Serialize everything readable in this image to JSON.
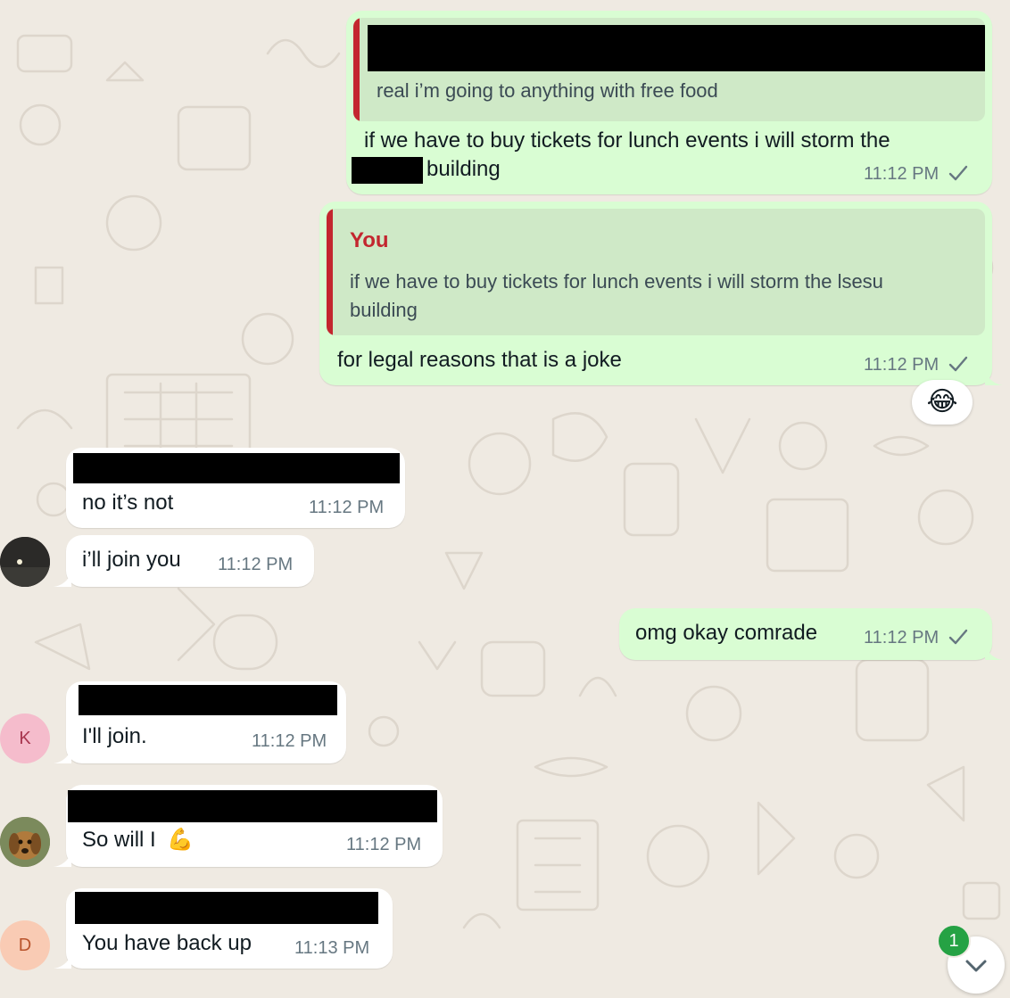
{
  "colors": {
    "background": "#efeae2",
    "outgoing_bubble": "#d9fdd3",
    "incoming_bubble": "#ffffff",
    "quote_bar": "#c3262f",
    "unread_badge": "#25a244",
    "avatar_k_bg": "#f5bccc",
    "avatar_k_fg": "#a8364f",
    "avatar_d_bg": "#f9cbb4",
    "avatar_d_fg": "#b9542c"
  },
  "messages": {
    "m1": {
      "quote_text": "real i’m going to anything with free food",
      "line1": "if we have to buy tickets for lunch events i will storm the",
      "line2": "building",
      "time": "11:12 PM"
    },
    "m2": {
      "quote_author": "You",
      "quote_line1": "if we have to buy tickets for lunch events i will storm the lsesu",
      "quote_line2": "building",
      "text": "for legal reasons that is a joke",
      "time": "11:12 PM",
      "reaction": "😂"
    },
    "m3": {
      "text": "no it’s not",
      "time": "11:12 PM"
    },
    "m4": {
      "text": "i’ll join you",
      "time": "11:12 PM"
    },
    "m5": {
      "text": "omg okay comrade",
      "time": "11:12 PM"
    },
    "m6": {
      "text": "I'll join.",
      "time": "11:12 PM",
      "avatar_letter": "K"
    },
    "m7": {
      "text": "So will I",
      "emoji": "💪",
      "time": "11:12 PM"
    },
    "m8": {
      "text": "You have back up",
      "time": "11:13 PM",
      "avatar_letter": "D"
    }
  },
  "scroll": {
    "unread_count": "1",
    "icon": "chevron-down-icon"
  },
  "icons": {
    "check": "check-icon",
    "photo_avatar": "photo-avatar"
  }
}
